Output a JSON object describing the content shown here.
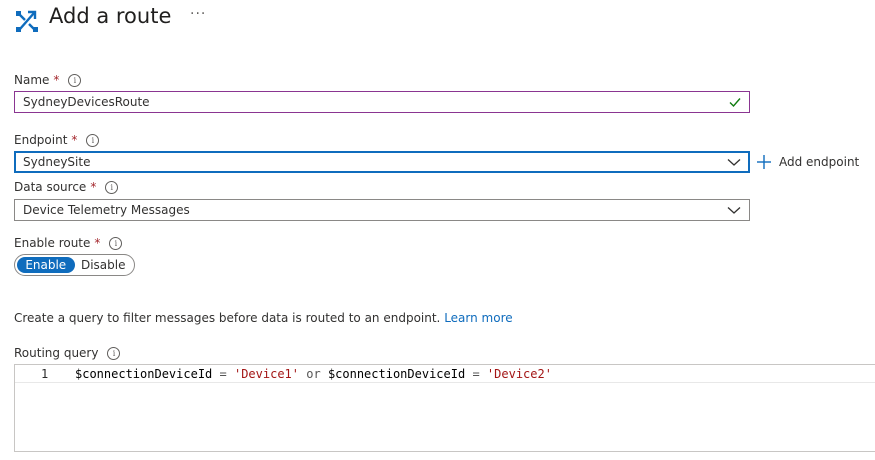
{
  "header": {
    "title": "Add a route",
    "more_label": "···"
  },
  "form": {
    "name": {
      "label": "Name",
      "required_mark": "*",
      "value": "SydneyDevicesRoute"
    },
    "endpoint": {
      "label": "Endpoint",
      "required_mark": "*",
      "value": "SydneySite",
      "add_label": "Add endpoint"
    },
    "data_source": {
      "label": "Data source",
      "required_mark": "*",
      "value": "Device Telemetry Messages"
    },
    "enable_route": {
      "label": "Enable route",
      "required_mark": "*",
      "options": [
        "Enable",
        "Disable"
      ],
      "selected": "Enable"
    },
    "info_glyph": "i"
  },
  "description": {
    "text": "Create a query to filter messages before data is routed to an endpoint.",
    "link": "Learn more"
  },
  "query": {
    "label": "Routing query",
    "line_number": "1",
    "tokens": {
      "var1": "$connectionDeviceId",
      "eq1": "=",
      "str1": "'Device1'",
      "or": "or",
      "var2": "$connectionDeviceId",
      "eq2": "=",
      "str2": "'Device2'"
    }
  },
  "colors": {
    "accent": "#0f6cbd",
    "focus_purple": "#8a3591",
    "valid_green": "#107c10",
    "required_red": "#a4262c"
  },
  "icons": {
    "route": "route-icon",
    "more": "more-icon",
    "info": "info-icon",
    "check": "checkmark-icon",
    "chevron": "chevron-down-icon",
    "add": "plus-icon"
  }
}
